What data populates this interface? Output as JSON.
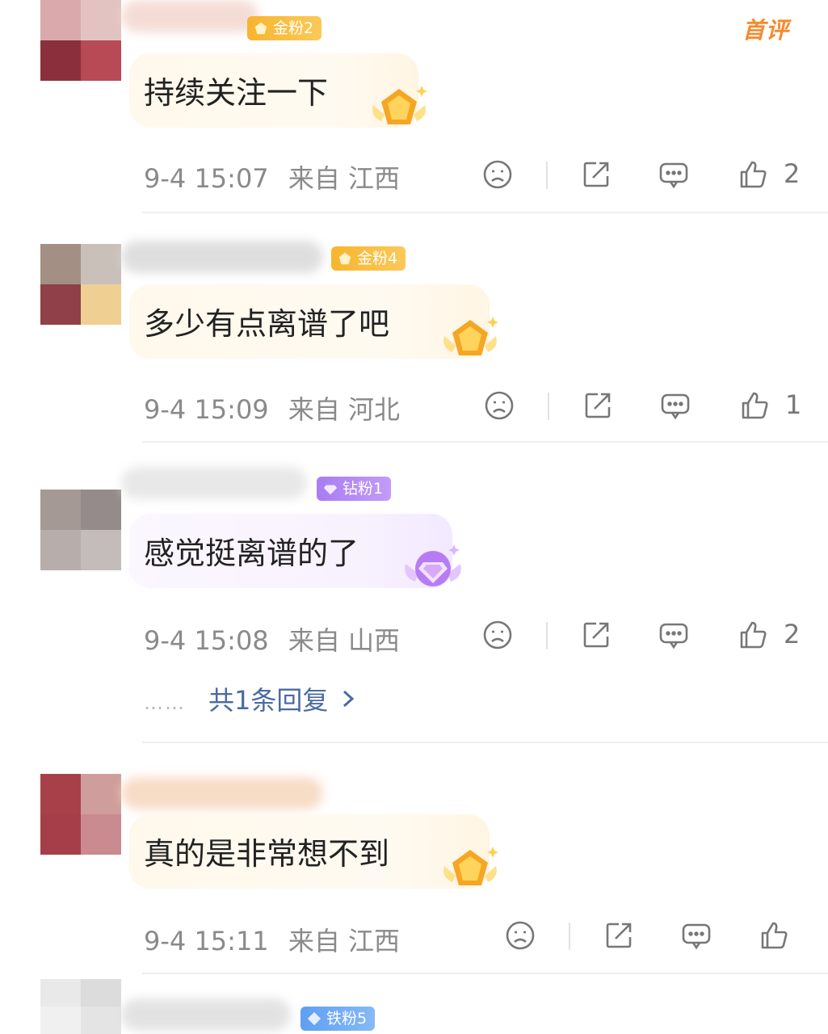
{
  "comments": [
    {
      "badge": "金粉2",
      "badge_type": "gold",
      "first_tag": "首评",
      "text": "持续关注一下",
      "time": "9-4 15:07",
      "location": "来自 江西",
      "likes": "2"
    },
    {
      "badge": "金粉4",
      "badge_type": "gold",
      "text": "多少有点离谱了吧",
      "time": "9-4 15:09",
      "location": "来自 河北",
      "likes": "1"
    },
    {
      "badge": "钻粉1",
      "badge_type": "diamond",
      "text": "感觉挺离谱的了",
      "time": "9-4 15:08",
      "location": "来自 山西",
      "likes": "2",
      "reply_dots": "……",
      "reply_link": "共1条回复"
    },
    {
      "badge": "",
      "badge_type": "gold",
      "text": "真的是非常想不到",
      "time": "9-4 15:11",
      "location": "来自 江西",
      "likes": ""
    },
    {
      "badge": "铁粉5",
      "badge_type": "iron"
    }
  ],
  "icons": {
    "dislike": "sad-face-icon",
    "share": "share-icon",
    "reply": "comment-bubble-icon",
    "like": "thumbs-up-icon",
    "chevron": "chevron-right-icon"
  },
  "colors": {
    "gold_badge": "#f7b52e",
    "diamond_badge": "#a77df3",
    "iron_badge": "#5f9ff2",
    "first_tag": "#f58a2c",
    "reply_link": "#4a6aa3",
    "meta_text": "#8a8a8a"
  }
}
